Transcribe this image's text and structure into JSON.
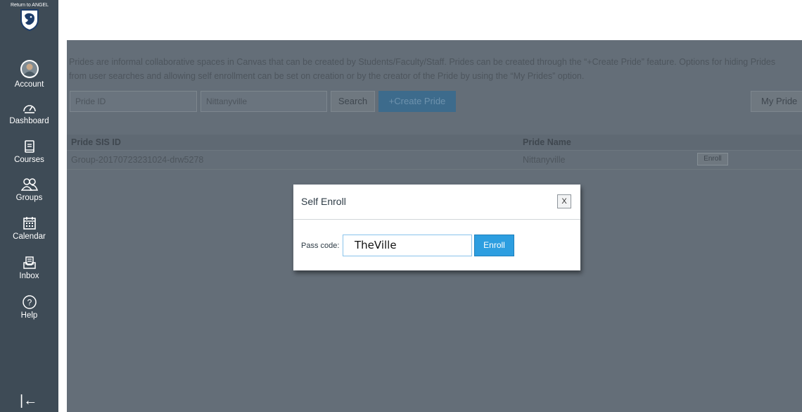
{
  "nav": {
    "logo_text": "Return to ANGEL",
    "items": [
      {
        "label": "Account",
        "icon": "avatar"
      },
      {
        "label": "Dashboard",
        "icon": "dashboard-icon"
      },
      {
        "label": "Courses",
        "icon": "book-icon"
      },
      {
        "label": "Groups",
        "icon": "groups-icon"
      },
      {
        "label": "Calendar",
        "icon": "calendar-icon"
      },
      {
        "label": "Inbox",
        "icon": "inbox-icon"
      },
      {
        "label": "Help",
        "icon": "help-icon"
      }
    ],
    "collapse_glyph": "|←"
  },
  "intro": "Prides are informal collaborative spaces in Canvas that can be created by Students/Faculty/Staff. Prides can be created through the “+Create Pride” feature. Options for hiding Prides from user searches and allowing self enrollment can be set on creation or by the creator of the Pride by using the “My Prides” option.",
  "search": {
    "pride_id_placeholder": "Pride ID",
    "pride_name_value": "Nittanyville",
    "search_label": "Search",
    "create_label": "+Create Pride",
    "my_prides_label": "My Pride"
  },
  "table": {
    "headers": [
      "Pride SIS ID",
      "Pride Name"
    ],
    "rows": [
      {
        "sis_id": "Group-20170723231024-drw5278",
        "name": "Nittanyville",
        "action": "Enroll"
      }
    ]
  },
  "modal": {
    "title": "Self Enroll",
    "close_label": "X",
    "passcode_label": "Pass code:",
    "passcode_value": "TheVille",
    "enroll_label": "Enroll"
  },
  "colors": {
    "nav_bg": "#3e4b56",
    "overlay": "#646e78",
    "primary_button": "#2d9ee0"
  }
}
